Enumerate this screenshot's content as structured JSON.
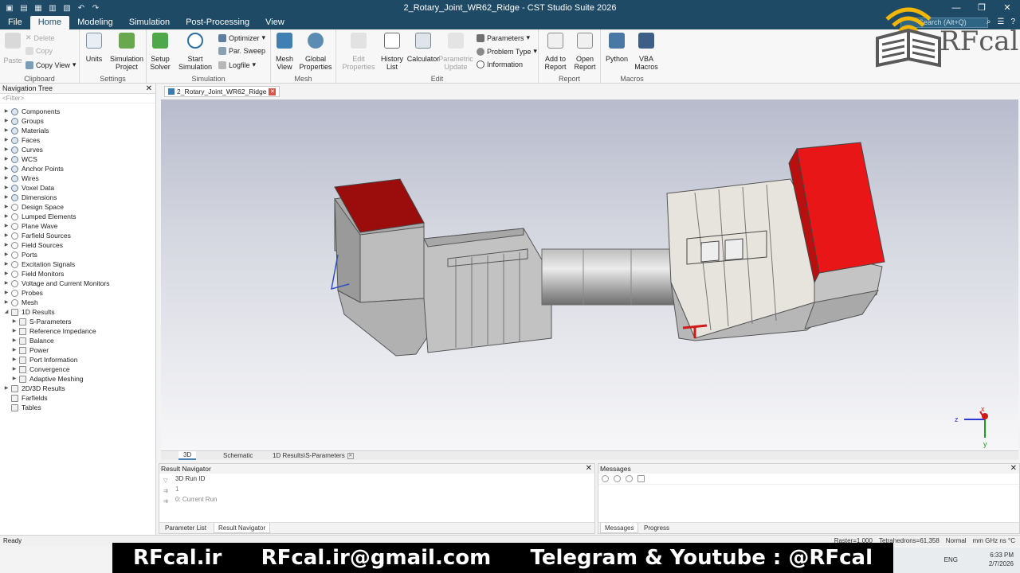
{
  "window": {
    "title": "2_Rotary_Joint_WR62_Ridge - CST Studio Suite 2026",
    "search_placeholder": "Search (Alt+Q)"
  },
  "menu": {
    "tabs": [
      "File",
      "Home",
      "Modeling",
      "Simulation",
      "Post-Processing",
      "View"
    ],
    "active": "Home"
  },
  "ribbon": {
    "clipboard": {
      "label": "Clipboard",
      "paste": "Paste",
      "delete": "Delete",
      "copy": "Copy",
      "copy_view": "Copy View"
    },
    "settings": {
      "label": "Settings",
      "units": "Units",
      "simulation_project": "Simulation Project"
    },
    "simulation": {
      "label": "Simulation",
      "setup_solver": "Setup Solver",
      "start_simulation": "Start Simulation",
      "optimizer": "Optimizer",
      "par_sweep": "Par. Sweep",
      "logfile": "Logfile"
    },
    "mesh": {
      "label": "Mesh",
      "mesh_view": "Mesh View",
      "global_properties": "Global Properties"
    },
    "edit": {
      "label": "Edit",
      "edit_properties": "Edit Properties",
      "history_list": "History List",
      "calculator": "Calculator",
      "parametric_update": "Parametric Update",
      "parameters": "Parameters",
      "problem_type": "Problem Type",
      "information": "Information"
    },
    "report": {
      "label": "Report",
      "add_to_report": "Add to Report",
      "open_report": "Open Report"
    },
    "macros": {
      "label": "Macros",
      "python": "Python",
      "vba_macros": "VBA Macros"
    }
  },
  "navigation": {
    "title": "Navigation Tree",
    "filter": "<Filter>",
    "items": [
      {
        "label": "Components",
        "level": 0,
        "icon": "comp"
      },
      {
        "label": "Groups",
        "level": 0,
        "icon": "comp"
      },
      {
        "label": "Materials",
        "level": 0,
        "icon": "comp"
      },
      {
        "label": "Faces",
        "level": 0,
        "icon": "comp"
      },
      {
        "label": "Curves",
        "level": 0,
        "icon": "comp"
      },
      {
        "label": "WCS",
        "level": 0,
        "icon": "comp"
      },
      {
        "label": "Anchor Points",
        "level": 0,
        "icon": "comp"
      },
      {
        "label": "Wires",
        "level": 0,
        "icon": "comp"
      },
      {
        "label": "Voxel Data",
        "level": 0,
        "icon": "comp"
      },
      {
        "label": "Dimensions",
        "level": 0,
        "icon": "comp"
      },
      {
        "label": "Design Space",
        "level": 0,
        "icon": "gear"
      },
      {
        "label": "Lumped Elements",
        "level": 0,
        "icon": "gear"
      },
      {
        "label": "Plane Wave",
        "level": 0,
        "icon": "gear"
      },
      {
        "label": "Farfield Sources",
        "level": 0,
        "icon": "gear"
      },
      {
        "label": "Field Sources",
        "level": 0,
        "icon": "gear"
      },
      {
        "label": "Ports",
        "level": 0,
        "icon": "gear"
      },
      {
        "label": "Excitation Signals",
        "level": 0,
        "icon": "gear"
      },
      {
        "label": "Field Monitors",
        "level": 0,
        "icon": "gear"
      },
      {
        "label": "Voltage and Current Monitors",
        "level": 0,
        "icon": "gear"
      },
      {
        "label": "Probes",
        "level": 0,
        "icon": "gear"
      },
      {
        "label": "Mesh",
        "level": 0,
        "icon": "gear"
      },
      {
        "label": "1D Results",
        "level": 0,
        "icon": "folder",
        "expanded": true
      },
      {
        "label": "S-Parameters",
        "level": 1,
        "icon": "folder"
      },
      {
        "label": "Reference Impedance",
        "level": 1,
        "icon": "folder"
      },
      {
        "label": "Balance",
        "level": 1,
        "icon": "folder"
      },
      {
        "label": "Power",
        "level": 1,
        "icon": "folder"
      },
      {
        "label": "Port Information",
        "level": 1,
        "icon": "folder"
      },
      {
        "label": "Convergence",
        "level": 1,
        "icon": "folder"
      },
      {
        "label": "Adaptive Meshing",
        "level": 1,
        "icon": "folder"
      },
      {
        "label": "2D/3D Results",
        "level": 0,
        "icon": "folder"
      },
      {
        "label": "Farfields",
        "level": 0,
        "icon": "folder",
        "noarrow": true
      },
      {
        "label": "Tables",
        "level": 0,
        "icon": "folder",
        "noarrow": true
      }
    ]
  },
  "document_tab": "2_Rotary_Joint_WR62_Ridge",
  "view_tabs": [
    "3D",
    "Schematic",
    "1D Results\\S-Parameters"
  ],
  "result_navigator": {
    "title": "Result Navigator",
    "header": "3D Run ID",
    "rows": [
      "1",
      "0: Current Run"
    ],
    "tabs": [
      "Parameter List",
      "Result Navigator"
    ]
  },
  "messages": {
    "title": "Messages",
    "tabs": [
      "Messages",
      "Progress"
    ]
  },
  "status": {
    "ready": "Ready",
    "raster": "Raster=1.000",
    "tetrahedrons": "Tetrahedrons=61,358",
    "mode": "Normal",
    "units": "mm  GHz  ns  °C"
  },
  "axes": {
    "x": "x",
    "y": "y",
    "z": "z"
  },
  "taskbar": {
    "lang": "ENG",
    "time": "6:33 PM",
    "date": "2/7/2026"
  },
  "branding": {
    "logo_text": "RFcal",
    "site": "RFcal.ir",
    "email": "RFcal.ir@gmail.com",
    "social": "Telegram & Youtube : @RFcal"
  },
  "colors": {
    "titlebar": "#1e4a66",
    "port_red": "#e81616",
    "port_dark_red": "#b50d0d",
    "metal": "#c9c9c9"
  }
}
